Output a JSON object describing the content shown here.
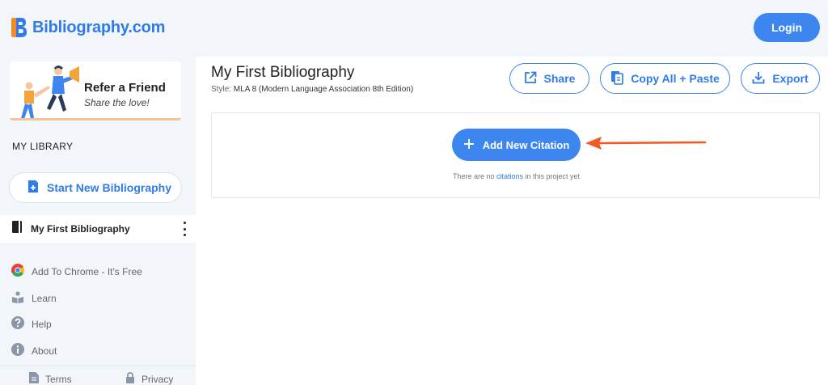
{
  "header": {
    "logo_text": "Bibliography.com",
    "login_label": "Login"
  },
  "sidebar": {
    "promo": {
      "title": "Refer a Friend",
      "subtitle": "Share the love!"
    },
    "library_heading": "MY LIBRARY",
    "start_button_label": "Start New Bibliography",
    "bibliographies": [
      {
        "label": "My First Bibliography"
      }
    ],
    "nav": [
      {
        "label": "Add To Chrome - It's Free",
        "icon": "chrome-icon"
      },
      {
        "label": "Learn",
        "icon": "book-reader-icon"
      },
      {
        "label": "Help",
        "icon": "question-icon"
      },
      {
        "label": "About",
        "icon": "info-icon"
      }
    ],
    "footer": [
      {
        "label": "Terms",
        "icon": "document-icon"
      },
      {
        "label": "Privacy",
        "icon": "lock-icon"
      }
    ]
  },
  "main": {
    "title": "My First Bibliography",
    "style_prefix": "Style:",
    "style_value": "MLA 8 (Modern Language Association 8th Edition)",
    "toolbar": {
      "share_label": "Share",
      "copy_label": "Copy All + Paste",
      "export_label": "Export"
    },
    "add_citation_label": "Add New Citation",
    "empty_message": {
      "before": "There are no",
      "link": "citations",
      "after": "in this project yet"
    }
  },
  "colors": {
    "brand_blue": "#3d86ef",
    "sidebar_bg": "#f2f5f9",
    "annotation_arrow": "#f15a22"
  }
}
